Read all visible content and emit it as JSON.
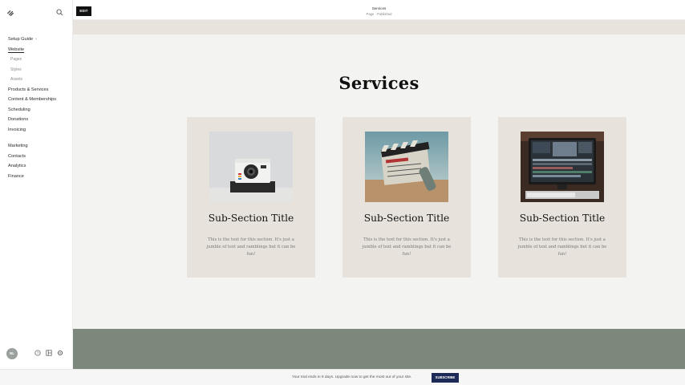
{
  "sidebar": {
    "items": [
      {
        "label": "Setup Guide",
        "kind": "main"
      },
      {
        "label": "Website",
        "kind": "main",
        "active": true
      },
      {
        "label": "Pages",
        "kind": "sub"
      },
      {
        "label": "Styles",
        "kind": "sub"
      },
      {
        "label": "Assets",
        "kind": "sub"
      },
      {
        "label": "Products & Services",
        "kind": "main"
      },
      {
        "label": "Content & Memberships",
        "kind": "main"
      },
      {
        "label": "Scheduling",
        "kind": "main"
      },
      {
        "label": "Donations",
        "kind": "main"
      },
      {
        "label": "Invoicing",
        "kind": "main"
      },
      {
        "label": "Marketing",
        "kind": "main",
        "gap_before": true
      },
      {
        "label": "Contacts",
        "kind": "main"
      },
      {
        "label": "Analytics",
        "kind": "main"
      },
      {
        "label": "Finance",
        "kind": "main"
      }
    ],
    "avatar_initials": "NL",
    "icons": [
      "squarespace-logo-icon",
      "search-icon",
      "help-icon",
      "layout-icon",
      "settings-icon"
    ]
  },
  "topbar": {
    "edit_label": "EDIT",
    "page_title": "Services",
    "page_status": "Page · Published"
  },
  "canvas": {
    "heading": "Services",
    "cards": [
      {
        "title": "Sub-Section Title",
        "body": "This is the text for this section. It's just a jumble of text and ramblings but it can be fun!",
        "image": "polaroid-camera"
      },
      {
        "title": "Sub-Section Title",
        "body": "This is the text for this section. It's just a jumble of text and ramblings but it can be fun!",
        "image": "film-clapperboard"
      },
      {
        "title": "Sub-Section Title",
        "body": "This is the text for this section. It's just a jumble of text and ramblings but it can be fun!",
        "image": "video-editing-monitor"
      }
    ],
    "colors": {
      "card_bg": "#e7e3dc",
      "green_band": "#7c887b",
      "beige_band": "#e8e4dd"
    }
  },
  "trial": {
    "text": "Your trial ends in 9 days. Upgrade now to get the most out of your site.",
    "subscribe_label": "SUBSCRIBE"
  }
}
